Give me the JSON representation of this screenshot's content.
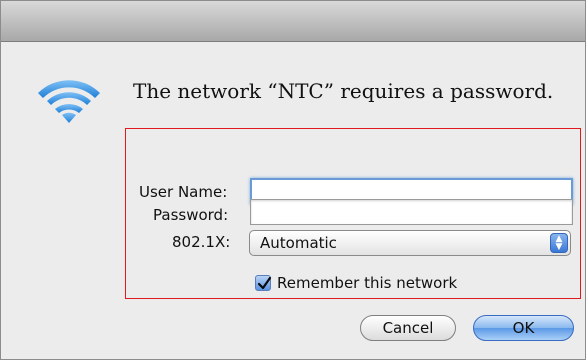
{
  "dialog": {
    "message": "The network “NTC” requires a password.",
    "icon": "wifi-icon"
  },
  "form": {
    "username_label": "User Name:",
    "username_value": "",
    "password_label": "Password:",
    "password_value": "",
    "security_label": "802.1X:",
    "security_selected": "Automatic",
    "remember_label": "Remember this network",
    "remember_checked": true
  },
  "buttons": {
    "cancel_label": "Cancel",
    "ok_label": "OK"
  },
  "colors": {
    "highlight_border": "#e0191c",
    "accent_blue": "#5b98e6"
  }
}
